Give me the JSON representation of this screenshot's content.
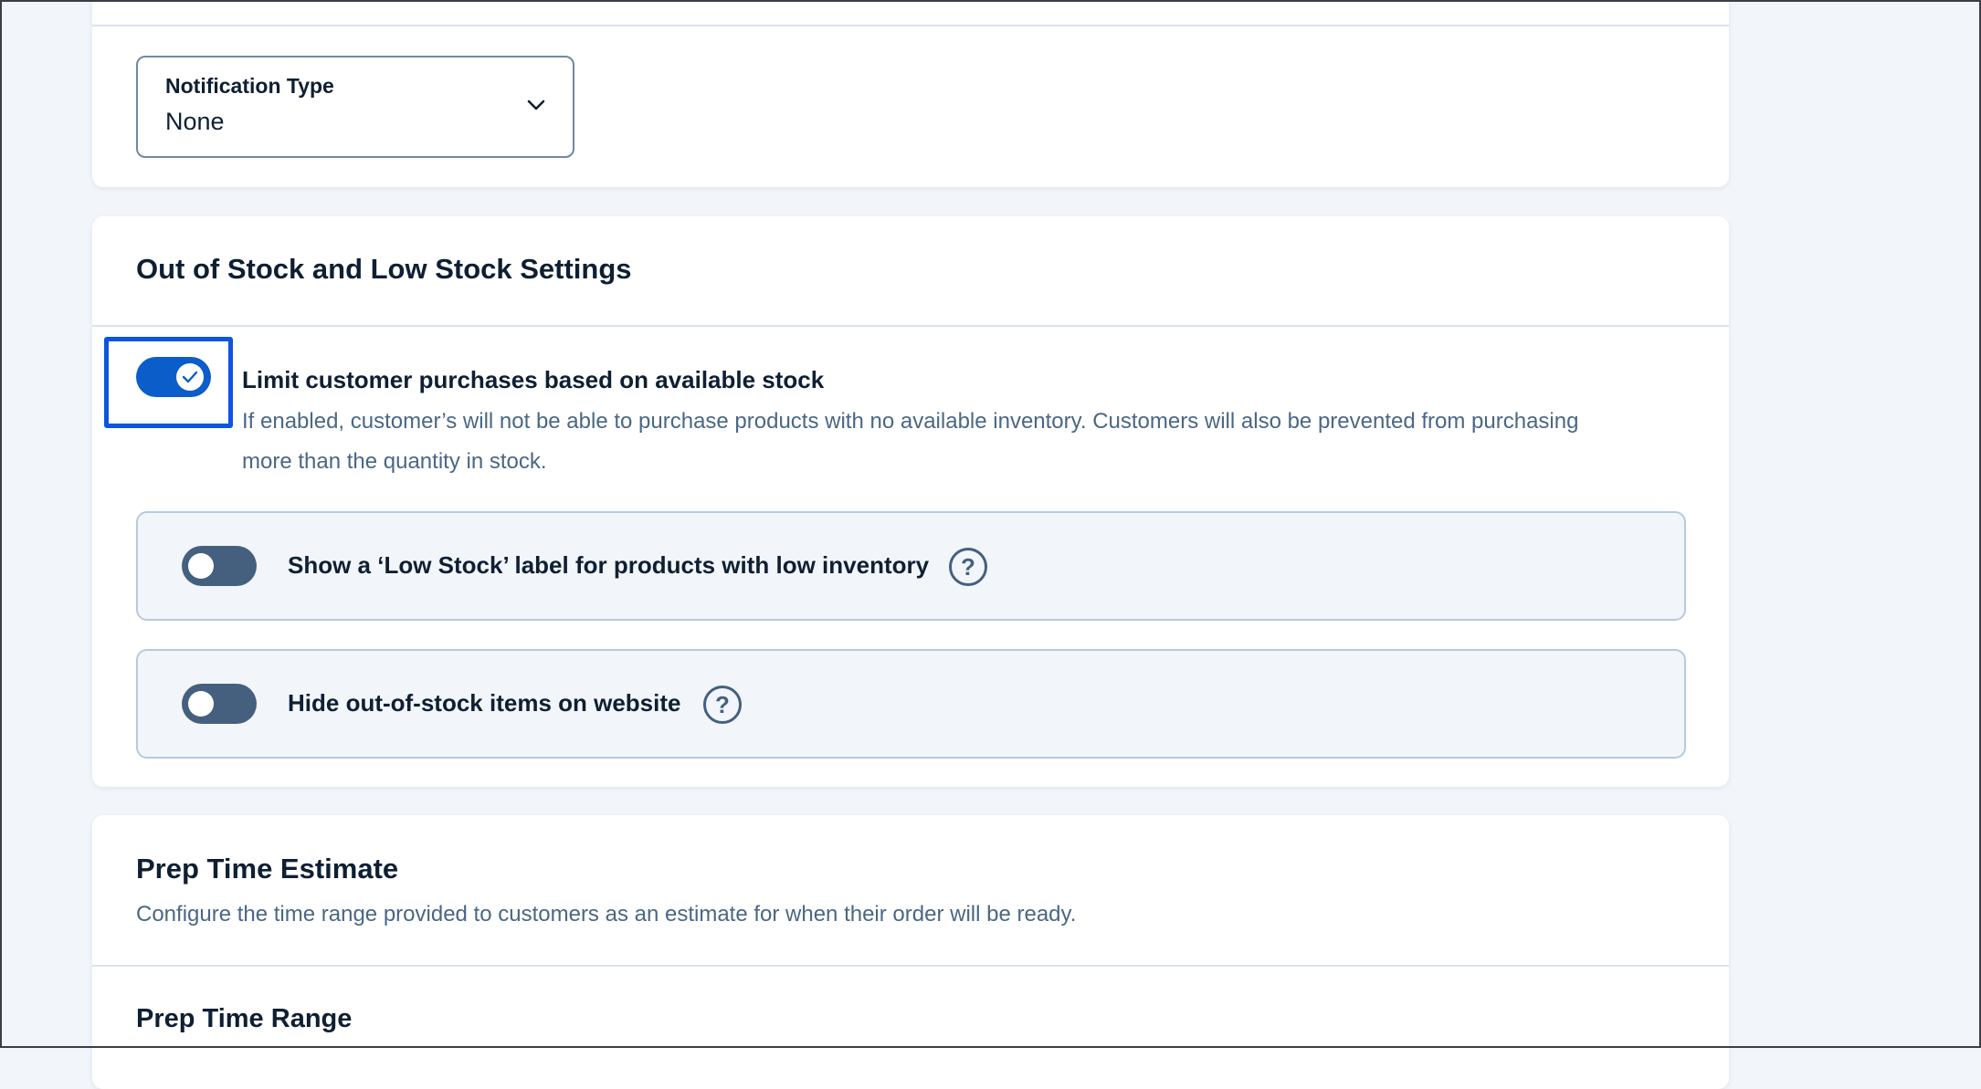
{
  "notification": {
    "label": "Notification Type",
    "value": "None"
  },
  "stock_settings": {
    "title": "Out of Stock and Low Stock Settings",
    "limit_purchases": {
      "label": "Limit customer purchases based on available stock",
      "description": "If enabled, customer’s will not be able to purchase products with no available inventory. Customers will also be prevented from purchasing more than the quantity in stock.",
      "enabled": true
    },
    "low_stock_label": {
      "label": "Show a ‘Low Stock’ label for products with low inventory",
      "help": "?",
      "enabled": false
    },
    "hide_out_of_stock": {
      "label": "Hide out-of-stock items on website",
      "help": "?",
      "enabled": false
    }
  },
  "prep_time": {
    "title": "Prep Time Estimate",
    "description": "Configure the time range provided to customers as an estimate for when their order will be ready.",
    "range_title": "Prep Time Range"
  },
  "colors": {
    "accent": "#0b5dc9",
    "focus_ring": "#0b55e0",
    "toggle_off": "#45607f",
    "background": "#f2f6fa"
  }
}
